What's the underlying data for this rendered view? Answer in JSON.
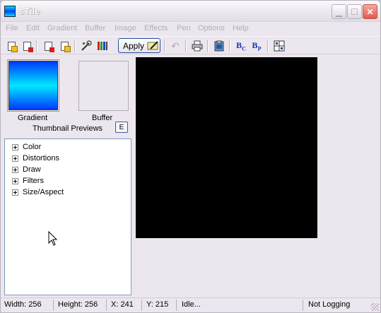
{
  "window": {
    "title": "sTile"
  },
  "menu": [
    "File",
    "Edit",
    "Gradient",
    "Buffer",
    "Image",
    "Effects",
    "Pen",
    "Options",
    "Help"
  ],
  "toolbar": {
    "apply_label": "Apply"
  },
  "thumbnails": {
    "gradient_label": "Gradient",
    "buffer_label": "Buffer",
    "caption": "Thumbnail Previews",
    "e_label": "E"
  },
  "tree": [
    "Color",
    "Distortions",
    "Draw",
    "Filters",
    "Size/Aspect"
  ],
  "status": {
    "width": "Width: 256",
    "height": "Height: 256",
    "x": "X: 241",
    "y": "Y: 215",
    "state": "Idle...",
    "logging": "Not Logging"
  },
  "colors": {
    "canvas": "#000000",
    "accent_blue": "#0038ff",
    "gradient_light": "#00e8ff"
  }
}
